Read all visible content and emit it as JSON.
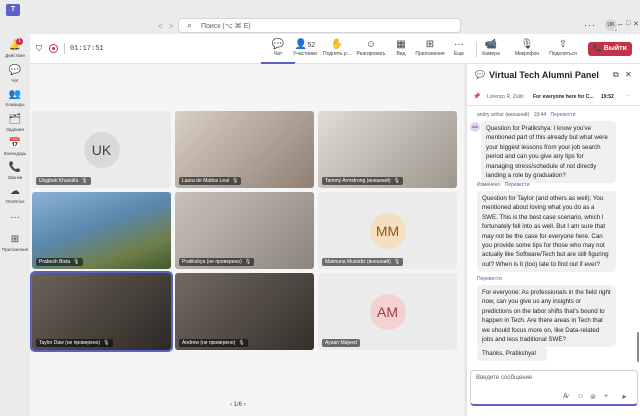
{
  "app": {
    "logo_text": "T"
  },
  "search": {
    "placeholder": "Поиск (⌥ ⌘ E)"
  },
  "user": {
    "initials": "UK"
  },
  "window": {
    "more": "···",
    "minimize": "–",
    "maximize": "□",
    "close": "✕"
  },
  "nav": {
    "back": "<",
    "forward": ">"
  },
  "rail": {
    "items": [
      {
        "label": "Действия",
        "icon": "bell-icon",
        "glyph": "🔔",
        "badge": "1"
      },
      {
        "label": "Чат",
        "icon": "chat-icon",
        "glyph": "💬"
      },
      {
        "label": "Команды",
        "icon": "teams-icon",
        "glyph": "👥"
      },
      {
        "label": "Задания",
        "icon": "assignments-icon",
        "glyph": "🗂"
      },
      {
        "label": "Календарь",
        "icon": "calendar-icon",
        "glyph": "📅"
      },
      {
        "label": "Звонки",
        "icon": "phone-icon",
        "glyph": "📞"
      },
      {
        "label": "OneDrive",
        "icon": "cloud-icon",
        "glyph": "☁"
      },
      {
        "label": "",
        "icon": "more-icon",
        "glyph": "···"
      },
      {
        "label": "Приложения",
        "icon": "apps-icon",
        "glyph": "⊞"
      }
    ]
  },
  "call": {
    "duration": "01:17:51",
    "tools": [
      {
        "label": "Чат",
        "icon": "chat-icon",
        "glyph": "💬"
      },
      {
        "label": "Участники",
        "icon": "people-icon",
        "glyph": "👤",
        "count": "52"
      },
      {
        "label": "Поднять р...",
        "icon": "raise-hand-icon",
        "glyph": "✋"
      },
      {
        "label": "Реагировать",
        "icon": "emoji-icon",
        "glyph": "☺"
      },
      {
        "label": "Вид",
        "icon": "view-icon",
        "glyph": "▦"
      },
      {
        "label": "Приложения",
        "icon": "add-app-icon",
        "glyph": "⊞"
      },
      {
        "label": "Еще",
        "icon": "more-icon",
        "glyph": "···"
      }
    ],
    "devices": [
      {
        "label": "Камера",
        "icon": "camera-icon",
        "glyph": "📹"
      },
      {
        "label": "Микрофон",
        "icon": "mic-off-icon",
        "glyph": "🎙"
      },
      {
        "label": "Поделиться",
        "icon": "share-icon",
        "glyph": "⇧"
      }
    ],
    "leave_label": "Выйти",
    "leave_glyph": "📞"
  },
  "participants": [
    {
      "name": "Ulugbek Khairulla",
      "initials": "UK",
      "bg": "#e8e8e8",
      "avatar_bg": "#d9d9d9",
      "avatar_fg": "#424242"
    },
    {
      "name": "Laura de Mattos Leal",
      "bg": "#b9a99c"
    },
    {
      "name": "Tammy Armstrong (внешний)",
      "bg": "#c8c2b7"
    },
    {
      "name": "Prabesh Bista",
      "bg": "#5f8fb4"
    },
    {
      "name": "Pratikshya (не проверено)",
      "bg": "#a9a29c"
    },
    {
      "name": "Maimuna Mustafiz (внешний)",
      "initials": "MM",
      "bg": "#e8e8e8",
      "avatar_bg": "#f6dfc1",
      "avatar_fg": "#8a5a17"
    },
    {
      "name": "Taylor Daw (не проверено)",
      "bg": "#4b4540"
    },
    {
      "name": "Andrew (не проверено)",
      "bg": "#514a44"
    },
    {
      "name": "Ayaan Majeed",
      "initials": "AM",
      "bg": "#e8e8e8",
      "avatar_bg": "#f4d2d2",
      "avatar_fg": "#a33b3b"
    }
  ],
  "pager": {
    "prev": "‹",
    "text": "1/6",
    "next": "›"
  },
  "chat": {
    "title": "Virtual Tech Alumni Panel",
    "pinned": {
      "author": "Lorenzo R. Zullo",
      "text": "For everyone here for C...",
      "time": "19:52"
    },
    "messages": [
      {
        "author": "andry arthur (внешний)",
        "time": "19:44",
        "translate": "Перевести",
        "avatar": "AA",
        "text": "Question for Pratikshya: I know you've mentioned part of this already but what were your biggest lessons from your job search period and can you give any tips for managing stress/schedule of not directly landing a role by graduation?"
      },
      {
        "author": "Изменено",
        "translate": "Перевести",
        "text": "Question for Taylor (and others as well): You mentioned about loving what you do as a SWE. This is the best case scenario, which I fortunately fell into as well. But I am sure that may not be the case for everyone here. Can you provide some tips for those who may not actually like Software/Tech but are still figuring out? When is it (too) late to find out if ever?"
      },
      {
        "translate": "Перевести",
        "text": "For everyone: As professionals in the field right now, can you give us any insights or predictions on the labor shifts that's bound to happen in Tech. Are there areas in Tech that we should focus more on, like Data-related jobs and less traditional SWE?"
      },
      {
        "text": "Thanks, Pratikshya!"
      }
    ],
    "compose_placeholder": "Введите сообщение"
  },
  "colors": {
    "accent": "#5b5fc7",
    "leave": "#c4314b",
    "badge": "#c4314b"
  }
}
